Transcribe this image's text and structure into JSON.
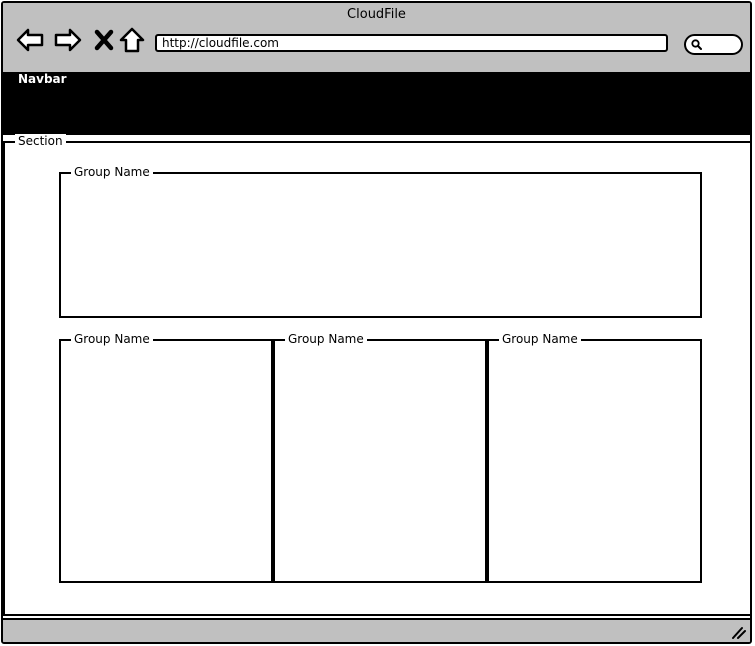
{
  "window": {
    "title": "CloudFile"
  },
  "toolbar": {
    "icons": [
      "back-arrow-icon",
      "forward-arrow-icon",
      "close-x-icon",
      "home-icon"
    ],
    "address": "http://cloudfile.com",
    "search_icon": "search-icon"
  },
  "navbar": {
    "label": "Navbar",
    "background": "#000000"
  },
  "section": {
    "label": "Section",
    "groups": [
      {
        "label": "Group Name"
      },
      {
        "label": "Group Name"
      },
      {
        "label": "Group Name"
      },
      {
        "label": "Group Name"
      }
    ]
  },
  "colors": {
    "chrome": "#c0c0c0",
    "border": "#000000",
    "background": "#ffffff"
  }
}
